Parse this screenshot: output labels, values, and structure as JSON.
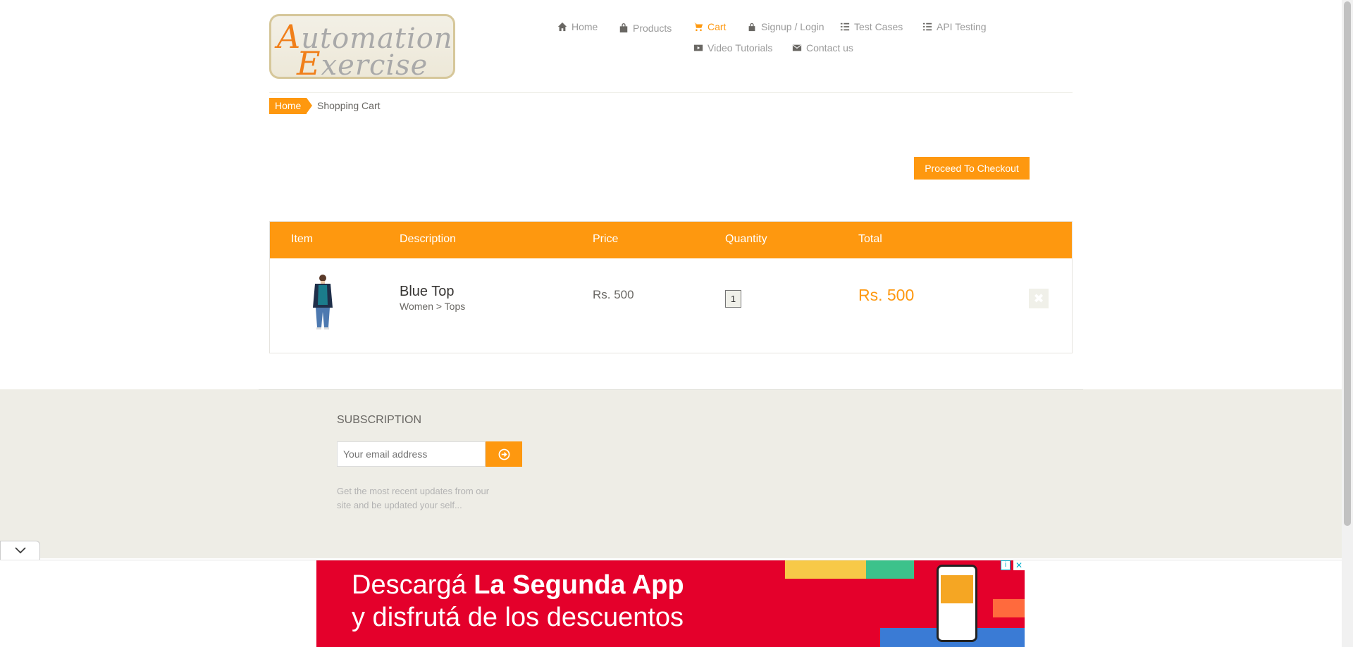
{
  "logo": {
    "line1": "Automation",
    "line2": "Exercise"
  },
  "nav": {
    "home": "Home",
    "products": "Products",
    "cart": "Cart",
    "signup": "Signup / Login",
    "test_cases": "Test Cases",
    "api_testing": "API Testing",
    "video_tutorials": "Video Tutorials",
    "contact_us": "Contact us"
  },
  "breadcrumb": {
    "home": "Home",
    "current": "Shopping Cart"
  },
  "checkout_label": "Proceed To Checkout",
  "table": {
    "headers": [
      "Item",
      "Description",
      "Price",
      "Quantity",
      "Total"
    ],
    "rows": [
      {
        "name": "Blue Top",
        "category": "Women > Tops",
        "price": "Rs. 500",
        "quantity": "1",
        "total": "Rs. 500"
      }
    ]
  },
  "subscription": {
    "title": "SUBSCRIPTION",
    "placeholder": "Your email address",
    "text": "Get the most recent updates from our site and be updated your self..."
  },
  "ad": {
    "line1_prefix": "Descargá ",
    "line1_bold": "La Segunda App",
    "line2": "y disfrutá de los descuentos",
    "info": "i",
    "close": "✕"
  },
  "colors": {
    "accent": "#fe980f",
    "footer_bg": "#eeede6",
    "ad_bg": "#e4002b"
  }
}
